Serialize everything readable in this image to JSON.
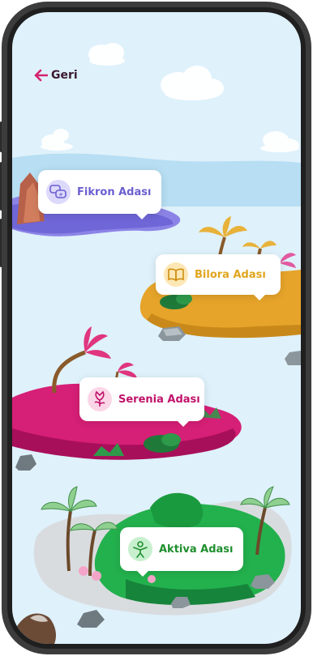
{
  "nav": {
    "back_label": "Geri"
  },
  "islands": [
    {
      "name": "Fikron Adası",
      "color": "#6a5fd0",
      "icon": "chat-bubbles-icon"
    },
    {
      "name": "Bilora Adası",
      "color": "#e0a51e",
      "icon": "open-book-icon"
    },
    {
      "name": "Serenia Adası",
      "color": "#c0136b",
      "icon": "flower-icon"
    },
    {
      "name": "Aktiva Adası",
      "color": "#1f8f2e",
      "icon": "person-exercise-icon"
    }
  ]
}
